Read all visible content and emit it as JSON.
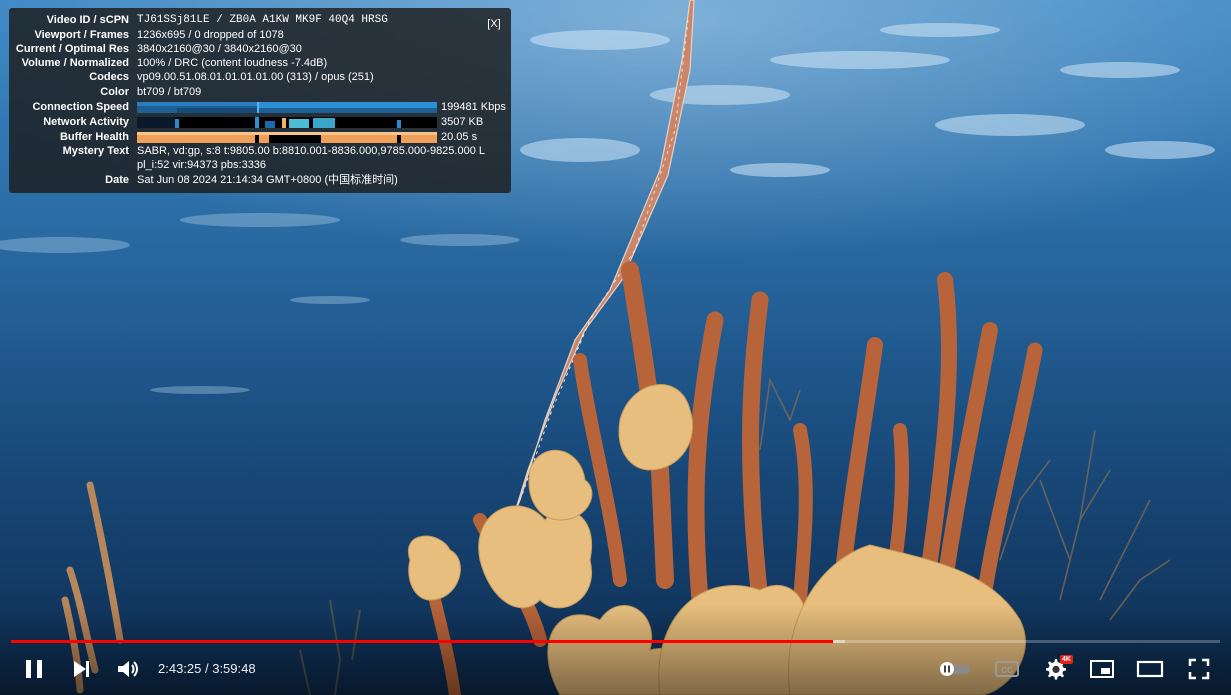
{
  "stats": {
    "close_label": "[X]",
    "rows": [
      {
        "label": "Video ID / sCPN",
        "value": "TJ61SSj81LE / ZB0A A1KW MK9F 40Q4 HRSG"
      },
      {
        "label": "Viewport / Frames",
        "value": "1236x695 / 0 dropped of 1078"
      },
      {
        "label": "Current / Optimal Res",
        "value": "3840x2160@30 / 3840x2160@30"
      },
      {
        "label": "Volume / Normalized",
        "value": "100% / DRC (content loudness -7.4dB)"
      },
      {
        "label": "Codecs",
        "value": "vp09.00.51.08.01.01.01.01.00 (313) / opus (251)"
      },
      {
        "label": "Color",
        "value": "bt709 / bt709"
      }
    ],
    "connection_speed": {
      "label": "Connection Speed",
      "value": "199481 Kbps"
    },
    "network_activity": {
      "label": "Network Activity",
      "value": "3507 KB"
    },
    "buffer_health": {
      "label": "Buffer Health",
      "value": "20.05 s"
    },
    "mystery": {
      "label": "Mystery Text",
      "line1": "SABR, vd:gp, s:8 t:9805.00 b:8810.001-8836.000,9785.000-9825.000 L",
      "line2": "pl_i:52 vir:94373 pbs:3336"
    },
    "date": {
      "label": "Date",
      "value": "Sat Jun 08 2024 21:14:34 GMT+0800 (中国标准时间)"
    }
  },
  "player": {
    "current_time": "2:43:25",
    "separator": " / ",
    "duration": "3:59:48",
    "progress_fraction": 0.68,
    "buffer_fraction": 0.69,
    "quality_badge": "4K",
    "accent_color": "#ff0000"
  },
  "icons": [
    "pause-icon",
    "next-icon",
    "volume-icon",
    "autoplay-toggle-icon",
    "subtitles-icon",
    "settings-icon",
    "miniplayer-icon",
    "theater-mode-icon",
    "fullscreen-icon"
  ]
}
